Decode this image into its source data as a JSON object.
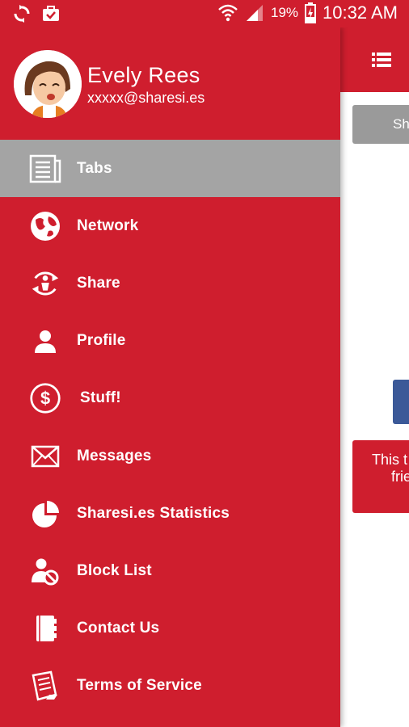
{
  "status_bar": {
    "battery_percent": "19%",
    "time": "10:32 AM",
    "icons": [
      "sync-icon",
      "briefcase-check-icon",
      "wifi-icon",
      "signal-icon",
      "battery-charging-icon"
    ]
  },
  "background": {
    "tab_button_label": "Sh",
    "notice_line1": "This t",
    "notice_line2": "frie"
  },
  "profile": {
    "name": "Evely Rees",
    "email": "xxxxx@sharesi.es"
  },
  "menu": {
    "items": [
      {
        "label": "Tabs",
        "icon": "newspaper-icon",
        "active": true
      },
      {
        "label": "Network",
        "icon": "globe-icon"
      },
      {
        "label": "Share",
        "icon": "share-cycle-icon"
      },
      {
        "label": "Profile",
        "icon": "person-icon"
      },
      {
        "label": "Stuff!",
        "icon": "dollar-icon"
      },
      {
        "label": "Messages",
        "icon": "envelope-icon"
      },
      {
        "label": "Sharesi.es Statistics",
        "icon": "pie-chart-icon"
      },
      {
        "label": "Block List",
        "icon": "block-user-icon"
      },
      {
        "label": "Contact Us",
        "icon": "contact-book-icon"
      },
      {
        "label": "Terms of Service",
        "icon": "document-icon"
      }
    ]
  },
  "colors": {
    "brand_red": "#cf1e2e",
    "active_item": "#a4a4a4",
    "facebook_blue": "#3b5998"
  }
}
